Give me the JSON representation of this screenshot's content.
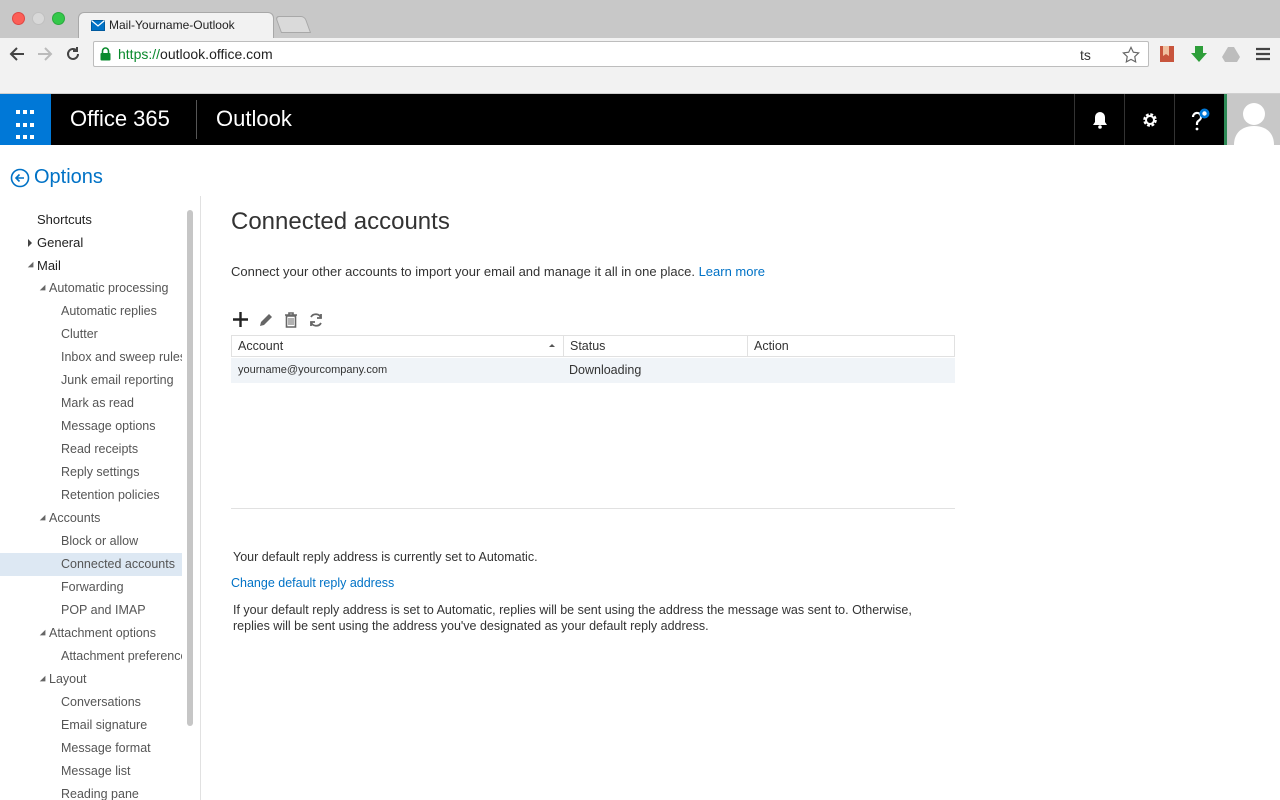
{
  "browser": {
    "tab_title": "Mail-Yourname-Outlook",
    "url_scheme": "https://",
    "url_host": "outlook.office.com",
    "omnibox_extra": "ts"
  },
  "header": {
    "brand": "Office 365",
    "app_name": "Outlook",
    "accent": "#0078d7"
  },
  "options": {
    "label": "Options"
  },
  "nav": {
    "items": [
      {
        "label": "Shortcuts",
        "level": 0,
        "caret": "none"
      },
      {
        "label": "General",
        "level": 0,
        "caret": "right"
      },
      {
        "label": "Mail",
        "level": 0,
        "caret": "down"
      },
      {
        "label": "Automatic processing",
        "level": 1,
        "caret": "down"
      },
      {
        "label": "Automatic replies",
        "level": 2
      },
      {
        "label": "Clutter",
        "level": 2
      },
      {
        "label": "Inbox and sweep rules",
        "level": 2
      },
      {
        "label": "Junk email reporting",
        "level": 2
      },
      {
        "label": "Mark as read",
        "level": 2
      },
      {
        "label": "Message options",
        "level": 2
      },
      {
        "label": "Read receipts",
        "level": 2
      },
      {
        "label": "Reply settings",
        "level": 2
      },
      {
        "label": "Retention policies",
        "level": 2
      },
      {
        "label": "Accounts",
        "level": 1,
        "caret": "down"
      },
      {
        "label": "Block or allow",
        "level": 2
      },
      {
        "label": "Connected accounts",
        "level": 2,
        "selected": true
      },
      {
        "label": "Forwarding",
        "level": 2
      },
      {
        "label": "POP and IMAP",
        "level": 2
      },
      {
        "label": "Attachment options",
        "level": 1,
        "caret": "down"
      },
      {
        "label": "Attachment preference",
        "level": 2
      },
      {
        "label": "Layout",
        "level": 1,
        "caret": "down"
      },
      {
        "label": "Conversations",
        "level": 2
      },
      {
        "label": "Email signature",
        "level": 2
      },
      {
        "label": "Message format",
        "level": 2
      },
      {
        "label": "Message list",
        "level": 2
      },
      {
        "label": "Reading pane",
        "level": 2
      }
    ]
  },
  "main": {
    "title": "Connected accounts",
    "intro": "Connect your other accounts to import your email and manage it all in one place.",
    "learn_more": "Learn more",
    "table": {
      "headers": {
        "account": "Account",
        "status": "Status",
        "action": "Action"
      },
      "rows": [
        {
          "account": "yourname@yourcompany.com",
          "status": "Downloading",
          "action": ""
        }
      ]
    },
    "reply_status": "Your default reply address is currently set to Automatic.",
    "reply_link": "Change default reply address",
    "reply_note": "If your default reply address is set to Automatic, replies will be sent using the address the message was sent to. Otherwise, replies will be sent using the address you've designated as your default reply address."
  }
}
